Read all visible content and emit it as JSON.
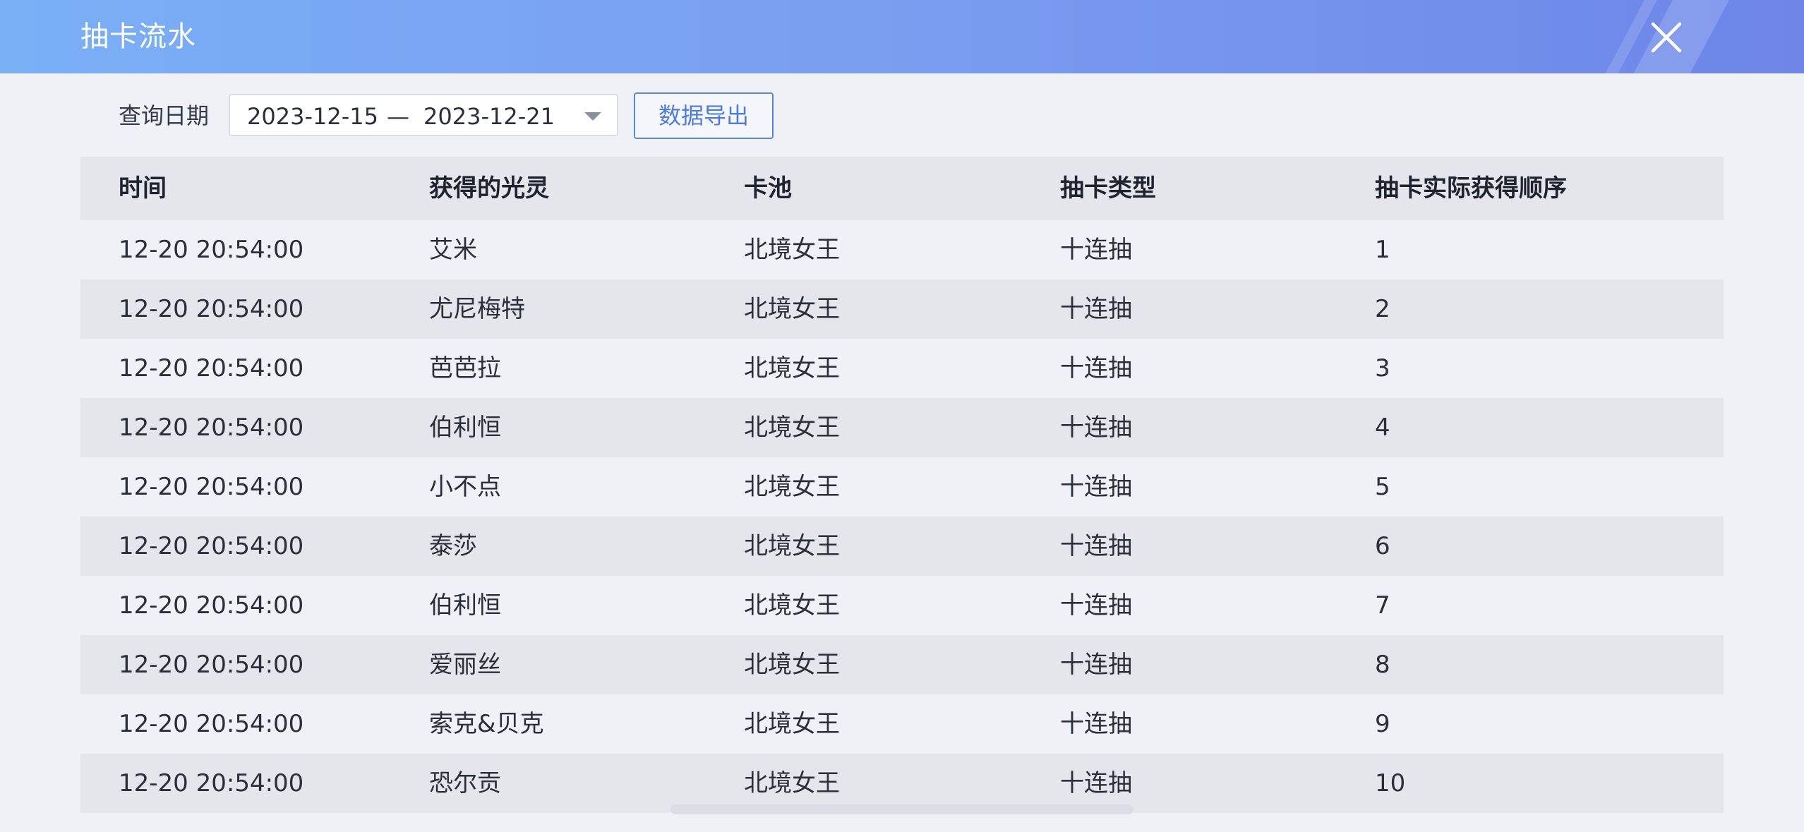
{
  "header": {
    "title": "抽卡流水",
    "close_icon": "close-icon"
  },
  "toolbar": {
    "date_label": "查询日期",
    "date_start": "2023-12-15",
    "date_separator": "—",
    "date_end": "2023-12-21",
    "export_label": "数据导出"
  },
  "table": {
    "columns": [
      "时间",
      "获得的光灵",
      "卡池",
      "抽卡类型",
      "抽卡实际获得顺序"
    ],
    "rows": [
      [
        "12-20 20:54:00",
        "艾米",
        "北境女王",
        "十连抽",
        "1"
      ],
      [
        "12-20 20:54:00",
        "尤尼梅特",
        "北境女王",
        "十连抽",
        "2"
      ],
      [
        "12-20 20:54:00",
        "芭芭拉",
        "北境女王",
        "十连抽",
        "3"
      ],
      [
        "12-20 20:54:00",
        "伯利恒",
        "北境女王",
        "十连抽",
        "4"
      ],
      [
        "12-20 20:54:00",
        "小不点",
        "北境女王",
        "十连抽",
        "5"
      ],
      [
        "12-20 20:54:00",
        "泰莎",
        "北境女王",
        "十连抽",
        "6"
      ],
      [
        "12-20 20:54:00",
        "伯利恒",
        "北境女王",
        "十连抽",
        "7"
      ],
      [
        "12-20 20:54:00",
        "爱丽丝",
        "北境女王",
        "十连抽",
        "8"
      ],
      [
        "12-20 20:54:00",
        "索克&贝克",
        "北境女王",
        "十连抽",
        "9"
      ],
      [
        "12-20 20:54:00",
        "恐尔贡",
        "北境女王",
        "十连抽",
        "10"
      ]
    ]
  },
  "colors": {
    "header_start": "#79b0f6",
    "header_end": "#6d86e8",
    "accent": "#5c86e6",
    "row_alt": "#e5e6ec",
    "background": "#f0f1f6"
  }
}
